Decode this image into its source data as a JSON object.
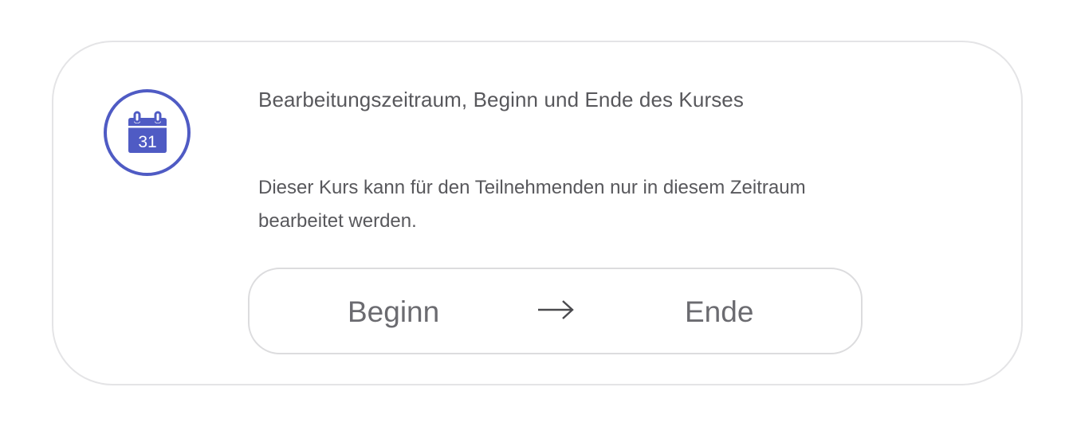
{
  "panel": {
    "icon": "calendar-icon",
    "calendar_day": "31",
    "title": "Bearbeitungszeitraum, Beginn und Ende des Kurses",
    "description": "Dieser Kurs kann für den Teilnehmenden nur in diesem Zeitraum bearbeitet werden."
  },
  "date_range": {
    "start_placeholder": "Beginn",
    "end_placeholder": "Ende",
    "separator_icon": "arrow-right-icon"
  },
  "colors": {
    "accent": "#4f5bc4",
    "text": "#58585c",
    "border": "#e4e4e6"
  }
}
